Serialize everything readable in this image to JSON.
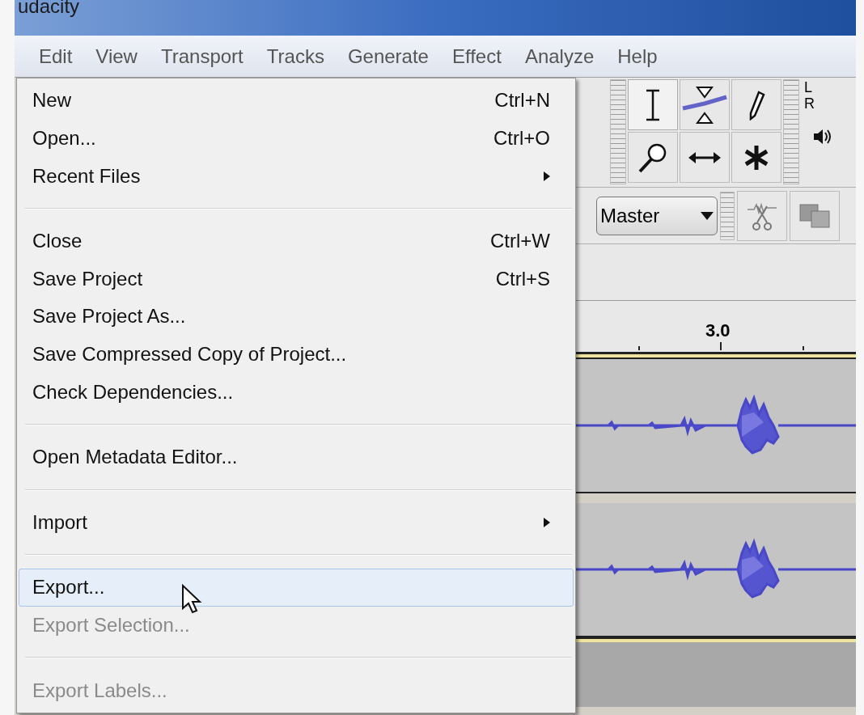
{
  "window": {
    "title": "udacity"
  },
  "menu_bar": [
    "Edit",
    "View",
    "Transport",
    "Tracks",
    "Generate",
    "Effect",
    "Analyze",
    "Help"
  ],
  "file_menu": [
    {
      "kind": "item",
      "label": "New",
      "shortcut": "Ctrl+N",
      "has_submenu": false,
      "disabled": false,
      "selected": false
    },
    {
      "kind": "item",
      "label": "Open...",
      "shortcut": "Ctrl+O",
      "has_submenu": false,
      "disabled": false,
      "selected": false
    },
    {
      "kind": "item",
      "label": "Recent Files",
      "has_submenu": true,
      "disabled": false,
      "selected": false
    },
    {
      "kind": "separator"
    },
    {
      "kind": "item",
      "label": "Close",
      "shortcut": "Ctrl+W",
      "has_submenu": false,
      "disabled": false,
      "selected": false
    },
    {
      "kind": "item",
      "label": "Save Project",
      "shortcut": "Ctrl+S",
      "has_submenu": false,
      "disabled": false,
      "selected": false
    },
    {
      "kind": "item",
      "label": "Save Project As...",
      "has_submenu": false,
      "disabled": false,
      "selected": false
    },
    {
      "kind": "item",
      "label": "Save Compressed Copy of Project...",
      "has_submenu": false,
      "disabled": false,
      "selected": false
    },
    {
      "kind": "item",
      "label": "Check Dependencies...",
      "has_submenu": false,
      "disabled": false,
      "selected": false
    },
    {
      "kind": "separator"
    },
    {
      "kind": "item",
      "label": "Open Metadata Editor...",
      "has_submenu": false,
      "disabled": false,
      "selected": false
    },
    {
      "kind": "separator"
    },
    {
      "kind": "item",
      "label": "Import",
      "has_submenu": true,
      "disabled": false,
      "selected": false
    },
    {
      "kind": "separator"
    },
    {
      "kind": "item",
      "label": "Export...",
      "has_submenu": false,
      "disabled": false,
      "selected": true
    },
    {
      "kind": "item",
      "label": "Export Selection...",
      "has_submenu": false,
      "disabled": true,
      "selected": false
    },
    {
      "kind": "separator"
    },
    {
      "kind": "item",
      "label": "Export Labels...",
      "has_submenu": false,
      "disabled": true,
      "selected": false
    }
  ],
  "meter": {
    "left_label": "L",
    "right_label": "R"
  },
  "mixer": {
    "value": "Master"
  },
  "ruler": {
    "label": "3.0"
  }
}
